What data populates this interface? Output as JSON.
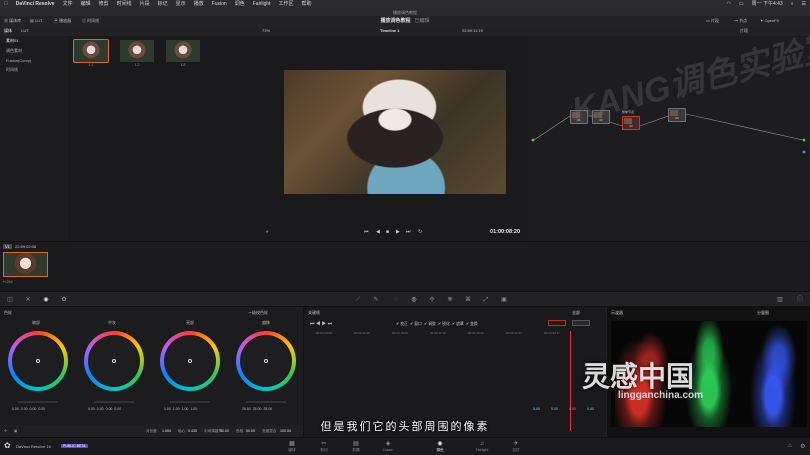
{
  "menubar": {
    "app": "DaVinci Resolve",
    "items": [
      "文件",
      "编辑",
      "修剪",
      "时间线",
      "片段",
      "标记",
      "显示",
      "播放",
      "Fusion",
      "调色",
      "Fairlight",
      "工作区",
      "帮助"
    ],
    "clock": "周一 下午4:43"
  },
  "project_bar": {
    "title": "播放调色教程"
  },
  "toolbar": {
    "left_items": [
      "媒体库",
      "LUT",
      "播放器",
      "时间线"
    ],
    "project_title": "播放调色教程",
    "project_sub": "已编辑",
    "right_items": [
      "片段",
      "节点",
      "OpenFX"
    ]
  },
  "left_panel": {
    "tabs": [
      "媒体",
      "LUT"
    ],
    "bins": [
      "素材01",
      "调色素材",
      "Fusion(Comp)",
      "时间线"
    ]
  },
  "media_pool": {
    "clips": [
      {
        "label": "1.1"
      },
      {
        "label": "1.2"
      },
      {
        "label": "1.8"
      }
    ]
  },
  "viewer": {
    "zoom": "73%",
    "timeline_name": "Timeline 1",
    "header_timecode": "22:59:11:19",
    "timecode": "01:00:08:20"
  },
  "node_editor": {
    "header_label": "片段",
    "nodes": [
      {
        "label": "01"
      },
      {
        "label": "02"
      },
      {
        "label": "03"
      },
      {
        "label": "04"
      }
    ],
    "group_label": "整体节点"
  },
  "watermark": {
    "text": "KANG调色实验室"
  },
  "timeline_strip": {
    "track": "V1",
    "timecode": "22:59:02:08",
    "codec": "H.264"
  },
  "color_wheels": {
    "panel_title": "色轮",
    "mode": "一级校色轮",
    "wheels": [
      {
        "name": "暗部",
        "values": "0.00  0.00  0.00  0.00"
      },
      {
        "name": "中灰",
        "values": "0.00  0.00  0.00  0.00"
      },
      {
        "name": "亮部",
        "values": "1.00  1.00  1.00  1.00"
      },
      {
        "name": "偏移",
        "values": "25.00  25.00  25.00"
      }
    ],
    "footer": {
      "contrast_label": "对比度",
      "contrast": "1.000",
      "pivot_label": "轴心",
      "pivot": "0.435",
      "md_label": "中间调细节",
      "md": "0.00",
      "color_boost_label": "色彩增强",
      "color_boost": "0.00",
      "shadows_label": "阴影",
      "shadows": "50.00",
      "highlights_label": "高光",
      "highlights": "50.00",
      "saturation_label": "饱和度",
      "saturation": "50.00",
      "hue_label": "色相",
      "hue": "50.00",
      "lum_mix_label": "亮度混合",
      "lum_mix": "100.00"
    }
  },
  "keyframes": {
    "title": "关键帧",
    "mode": "全部",
    "filters": [
      "校正",
      "窗口",
      "调整",
      "锐化",
      "遮罩",
      "变换"
    ],
    "ruler": [
      "00:00:10:08",
      "00:00:12:18",
      "00:00:15:03",
      "00:00:17:12",
      "00:00:19:22",
      "00:00:22:07",
      "00:00:24:17"
    ]
  },
  "scope": {
    "title": "示波器",
    "mode": "分量图",
    "values": [
      "0.00",
      "0.00",
      "0.00",
      "0.00"
    ],
    "colors": {
      "red": "#e0302a",
      "green": "#2fd65a",
      "blue": "#3a5cff"
    }
  },
  "subtitle": "但是我们它的头部周围的像素",
  "logo": {
    "name": "灵感中国",
    "url": "lingganchina.com"
  },
  "dock": {
    "app_label": "DaVinci Resolve 16",
    "badge": "PUBLIC BETA",
    "pages": [
      "媒体",
      "剪切",
      "剪辑",
      "Fusion",
      "调色",
      "Fairlight",
      "交付"
    ],
    "active": "调色"
  }
}
